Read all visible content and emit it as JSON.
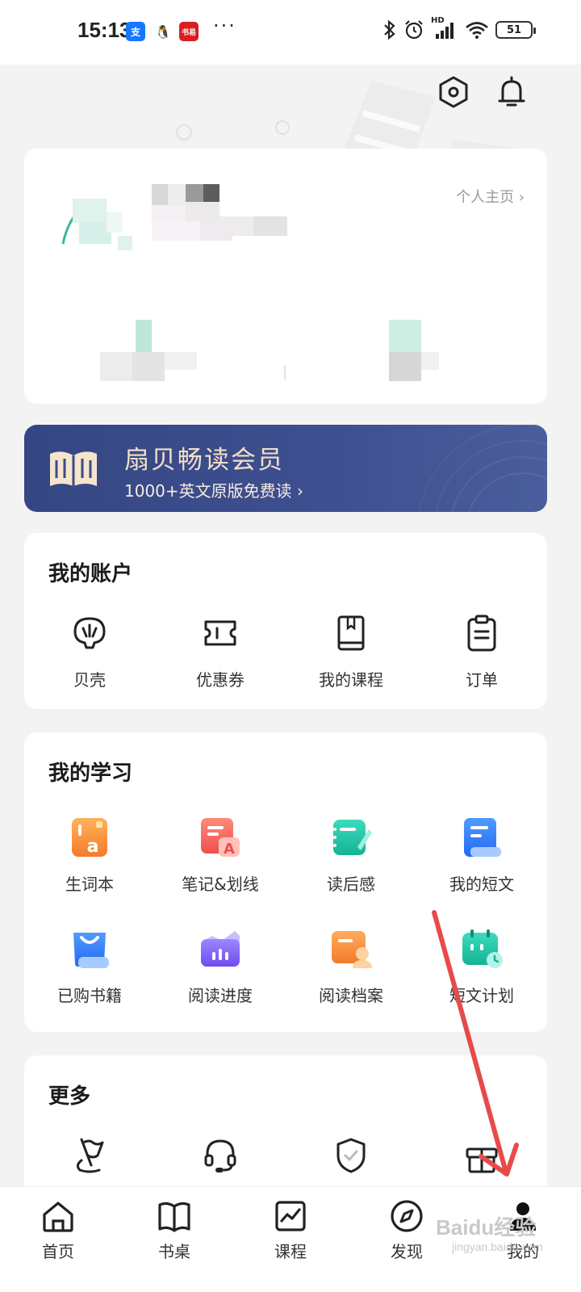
{
  "status_bar": {
    "time": "15:13",
    "apps": [
      {
        "name": "alipay",
        "text": "支",
        "color": "#1677ff"
      },
      {
        "name": "qq",
        "text": "🐧",
        "color": "#ffffff"
      },
      {
        "name": "taobao",
        "text": "书易",
        "color": "#d81e1e"
      }
    ],
    "more": "···",
    "network_label": "HD",
    "battery": "51"
  },
  "header": {
    "settings_icon": "hexagon-settings-icon",
    "notification_icon": "bell-icon"
  },
  "profile": {
    "homepage_link": "个人主页 ›",
    "avatar_icon": "avatar-blurred"
  },
  "member_banner": {
    "title": "扇贝畅读会员",
    "subtitle": "1000+英文原版免费读 ›",
    "icon": "open-book-icon"
  },
  "account": {
    "title": "我的账户",
    "items": [
      {
        "label": "贝壳",
        "icon": "shell-icon"
      },
      {
        "label": "优惠券",
        "icon": "coupon-icon"
      },
      {
        "label": "我的课程",
        "icon": "course-book-icon"
      },
      {
        "label": "订单",
        "icon": "clipboard-icon"
      }
    ]
  },
  "learning": {
    "title": "我的学习",
    "items": [
      {
        "label": "生词本",
        "icon": "vocab-book-icon"
      },
      {
        "label": "笔记&划线",
        "icon": "notes-icon"
      },
      {
        "label": "读后感",
        "icon": "review-icon"
      },
      {
        "label": "我的短文",
        "icon": "my-essay-icon"
      },
      {
        "label": "已购书籍",
        "icon": "purchased-books-icon"
      },
      {
        "label": "阅读进度",
        "icon": "reading-progress-icon"
      },
      {
        "label": "阅读档案",
        "icon": "reading-archive-icon"
      },
      {
        "label": "短文计划",
        "icon": "essay-plan-icon"
      }
    ]
  },
  "more": {
    "title": "更多",
    "items": [
      {
        "icon": "flag-icon"
      },
      {
        "icon": "headset-icon"
      },
      {
        "icon": "shield-check-icon"
      },
      {
        "icon": "gift-icon"
      }
    ]
  },
  "bottom_nav": {
    "items": [
      {
        "label": "首页",
        "icon": "home-icon"
      },
      {
        "label": "书桌",
        "icon": "book-desk-icon"
      },
      {
        "label": "课程",
        "icon": "course-chart-icon"
      },
      {
        "label": "发现",
        "icon": "compass-icon"
      },
      {
        "label": "我的",
        "icon": "person-icon"
      }
    ]
  },
  "watermark": {
    "text": "Baidu经验",
    "sub": "jingyan.baidu.com"
  },
  "colors": {
    "banner": "#3a4b8a",
    "banner_text": "#f3dfc7",
    "annotation_arrow": "#e84a4a"
  }
}
